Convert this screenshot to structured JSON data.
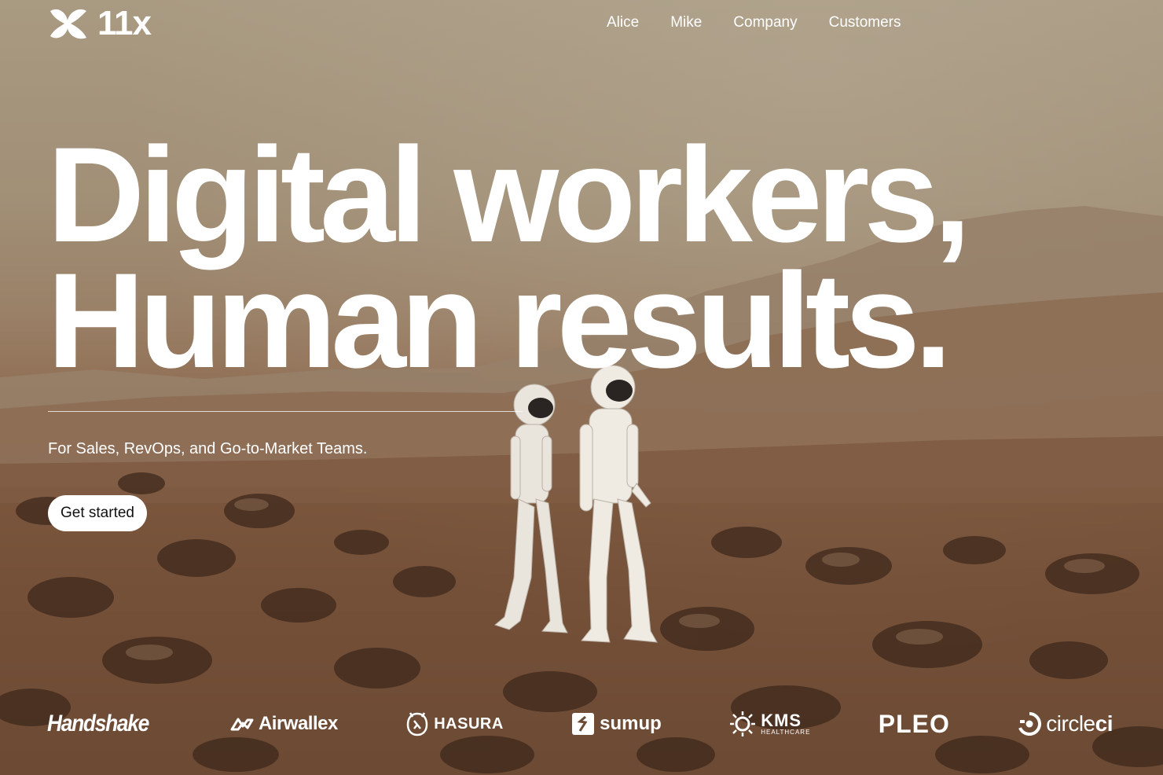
{
  "brand": {
    "name": "11x",
    "logo_icon": "11x-mark-icon"
  },
  "nav": {
    "items": [
      {
        "label": "Alice"
      },
      {
        "label": "Mike"
      },
      {
        "label": "Company"
      },
      {
        "label": "Customers"
      }
    ]
  },
  "hero": {
    "title_line1": "Digital workers,",
    "title_line2": "Human results.",
    "subtitle": "For Sales, RevOps, and Go-to-Market Teams.",
    "cta_label": "Get started",
    "background_image": "astronauts-on-desert-planet"
  },
  "customer_logos": [
    {
      "name": "Handshake"
    },
    {
      "name": "Airwallex"
    },
    {
      "name": "HASURA"
    },
    {
      "name": "sumup"
    },
    {
      "name": "KMS",
      "sub": "HEALTHCARE"
    },
    {
      "name": "PLEO"
    },
    {
      "name_regular": "circle",
      "name_bold": "ci"
    }
  ],
  "colors": {
    "text": "#ffffff",
    "cta_background": "#ffffff",
    "cta_text": "#111111",
    "sky": "#a99a82",
    "ground": "#5a3a27"
  }
}
